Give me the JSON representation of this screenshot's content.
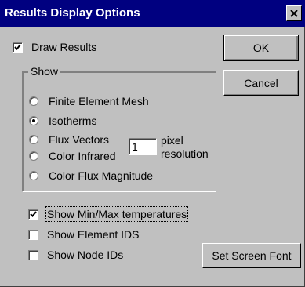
{
  "window": {
    "title": "Results Display Options",
    "close_label": "×"
  },
  "options": {
    "draw_results": {
      "label": "Draw Results",
      "checked": true
    }
  },
  "show_group": {
    "legend": "Show",
    "radios": [
      {
        "label": "Finite Element Mesh",
        "selected": false
      },
      {
        "label": "Isotherms",
        "selected": true
      },
      {
        "label": "Flux Vectors",
        "selected": false
      },
      {
        "label": "Color Infrared",
        "selected": false
      },
      {
        "label": "Color Flux Magnitude",
        "selected": false
      }
    ],
    "resolution": {
      "value": "1",
      "label_line1": "pixel",
      "label_line2": "resolution"
    }
  },
  "checkboxes": [
    {
      "label": "Show Min/Max temperatures",
      "checked": true
    },
    {
      "label": "Show Element IDS",
      "checked": false
    },
    {
      "label": "Show Node IDs",
      "checked": false
    }
  ],
  "buttons": {
    "ok": "OK",
    "cancel": "Cancel",
    "set_screen_font": "Set Screen Font"
  }
}
